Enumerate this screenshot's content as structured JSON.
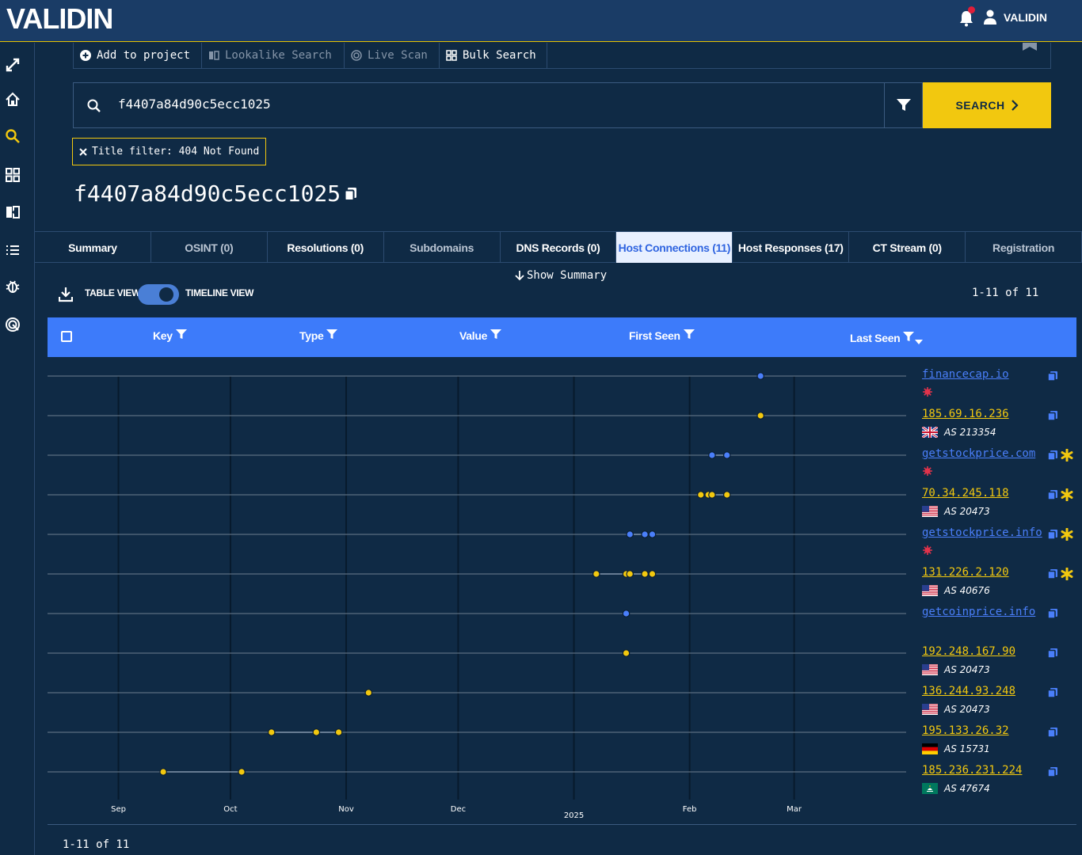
{
  "header": {
    "logo": "VALIDIN",
    "user": "VALIDIN"
  },
  "toolbar": [
    {
      "label": "Add to project",
      "icon": "plus-circle-icon",
      "enabled": true
    },
    {
      "label": "Lookalike Search",
      "icon": "lookalike-icon",
      "enabled": false
    },
    {
      "label": "Live Scan",
      "icon": "radar-icon",
      "enabled": false
    },
    {
      "label": "Bulk Search",
      "icon": "grid-icon",
      "enabled": true
    }
  ],
  "search": {
    "value": "f4407a84d90c5ecc1025",
    "button": "SEARCH"
  },
  "filter_chip": "Title filter: 404 Not Found",
  "result_title": "f4407a84d90c5ecc1025",
  "tabs": [
    {
      "label": "Summary",
      "state": "normal"
    },
    {
      "label": "OSINT (0)",
      "state": "dim"
    },
    {
      "label": "Resolutions (0)",
      "state": "normal"
    },
    {
      "label": "Subdomains",
      "state": "dim"
    },
    {
      "label": "DNS Records (0)",
      "state": "normal"
    },
    {
      "label": "Host Connections (11)",
      "state": "active"
    },
    {
      "label": "Host Responses (17)",
      "state": "normal"
    },
    {
      "label": "CT Stream (0)",
      "state": "normal"
    },
    {
      "label": "Registration",
      "state": "dim"
    }
  ],
  "show_summary": "Show Summary",
  "view_toggle": {
    "left": "TABLE VIEW",
    "right": "TIMELINE VIEW",
    "selected": "TIMELINE VIEW"
  },
  "pager": "1-11 of 11",
  "columns": [
    "Key",
    "Type",
    "Value",
    "First Seen",
    "Last Seen"
  ],
  "colors": {
    "domain": "#4a7ffa",
    "ip": "#f2c80f",
    "accent": "#f2c80f",
    "header": "#3d7bfa",
    "virus": "#e0334b"
  },
  "chart_data": {
    "type": "timeline",
    "x_ticks": [
      "Sep",
      "Oct",
      "Nov",
      "Dec",
      "2025",
      "Feb",
      "Mar"
    ],
    "x_ticks_dates": [
      "2024-09-01",
      "2024-10-01",
      "2024-11-01",
      "2024-12-01",
      "2025-01-01",
      "2025-02-01",
      "2025-03-01"
    ],
    "xlim": [
      "2024-08-13",
      "2025-03-31"
    ],
    "rows": [
      {
        "label": "financecap.io",
        "kind": "domain",
        "sub": "",
        "flag": "",
        "virus": true,
        "star": false,
        "points": [
          "2025-02-20"
        ]
      },
      {
        "label": "185.69.16.236",
        "kind": "ip",
        "sub": "AS 213354",
        "flag": "gb",
        "virus": false,
        "star": false,
        "points": [
          "2025-02-20"
        ]
      },
      {
        "label": "getstockprice.com",
        "kind": "domain",
        "sub": "",
        "flag": "",
        "virus": true,
        "star": true,
        "points": [
          "2025-02-07",
          "2025-02-11"
        ]
      },
      {
        "label": "70.34.245.118",
        "kind": "ip",
        "sub": "AS 20473",
        "flag": "us",
        "virus": false,
        "star": true,
        "points": [
          "2025-02-04",
          "2025-02-06",
          "2025-02-07",
          "2025-02-11"
        ]
      },
      {
        "label": "getstockprice.info",
        "kind": "domain",
        "sub": "",
        "flag": "",
        "virus": true,
        "star": true,
        "points": [
          "2025-01-16",
          "2025-01-20",
          "2025-01-22"
        ]
      },
      {
        "label": "131.226.2.120",
        "kind": "ip",
        "sub": "AS 40676",
        "flag": "us",
        "virus": false,
        "star": true,
        "points": [
          "2025-01-07",
          "2025-01-15",
          "2025-01-16",
          "2025-01-20",
          "2025-01-22"
        ]
      },
      {
        "label": "getcoinprice.info",
        "kind": "domain",
        "sub": "",
        "flag": "",
        "virus": false,
        "star": false,
        "points": [
          "2025-01-15"
        ]
      },
      {
        "label": "192.248.167.90",
        "kind": "ip",
        "sub": "AS 20473",
        "flag": "us",
        "virus": false,
        "star": false,
        "points": [
          "2025-01-15"
        ]
      },
      {
        "label": "136.244.93.248",
        "kind": "ip",
        "sub": "AS 20473",
        "flag": "us",
        "virus": false,
        "star": false,
        "points": [
          "2024-11-07"
        ]
      },
      {
        "label": "195.133.26.32",
        "kind": "ip",
        "sub": "AS 15731",
        "flag": "de",
        "virus": false,
        "star": false,
        "points": [
          "2024-10-12",
          "2024-10-24",
          "2024-10-30"
        ]
      },
      {
        "label": "185.236.231.224",
        "kind": "ip",
        "sub": "AS 47674",
        "flag": "mo",
        "virus": false,
        "star": false,
        "points": [
          "2024-09-13",
          "2024-10-04"
        ]
      }
    ]
  }
}
